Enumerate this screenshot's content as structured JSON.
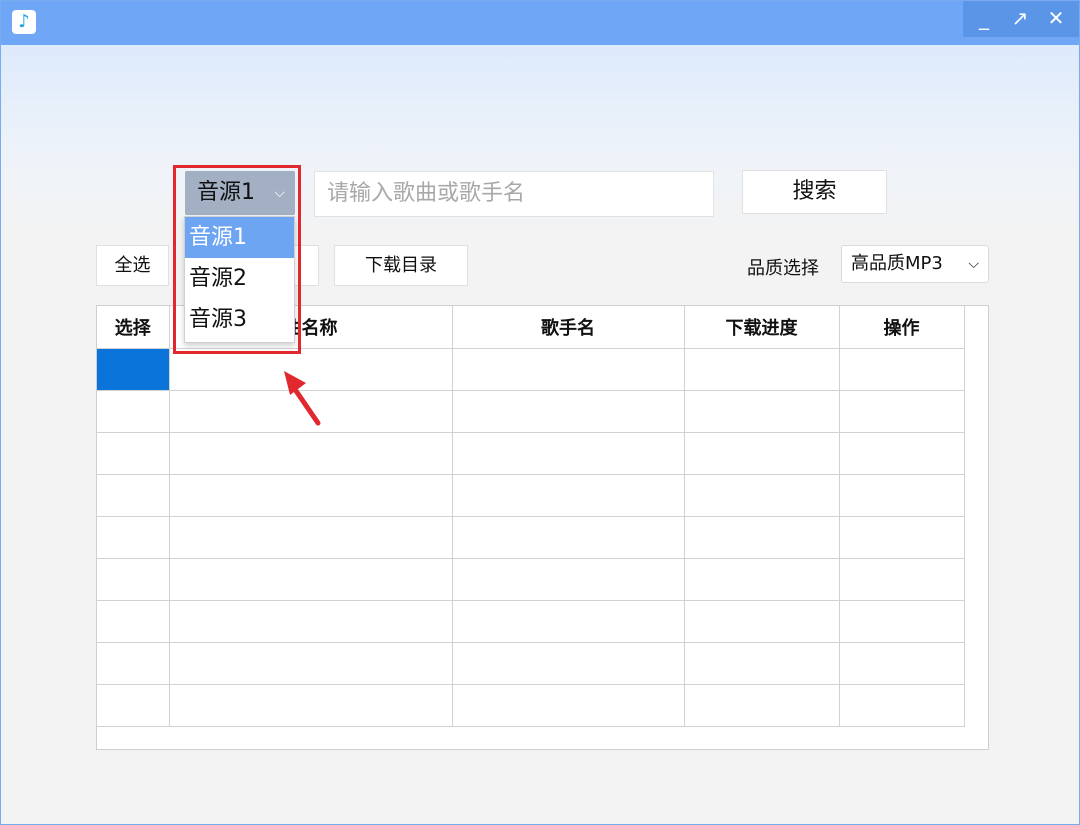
{
  "window": {
    "app_icon": "music-note-icon",
    "minimize": "_",
    "maximize": "↗",
    "close": "✕",
    "titlebar_color": "#6fa6f5"
  },
  "search": {
    "source_selected": "音源1",
    "placeholder": "请输入歌曲或歌手名",
    "button_label": "搜索"
  },
  "source_dropdown": {
    "options": [
      "音源1",
      "音源2",
      "音源3"
    ],
    "active_index": 0,
    "active_color": "#6ea5f3"
  },
  "toolbar": {
    "select_all": "全选",
    "download_dir": "下载目录",
    "quality_label": "品质选择",
    "quality_value": "高品质MP3"
  },
  "table": {
    "columns": [
      "选择",
      "曲名称",
      "歌手名",
      "下载进度",
      "操作"
    ],
    "visible_header_fragment": "曲名称",
    "row_count": 9,
    "selected_row": 0,
    "selected_color": "#0a74da"
  },
  "annotation": {
    "highlight_color": "#e0282e"
  }
}
